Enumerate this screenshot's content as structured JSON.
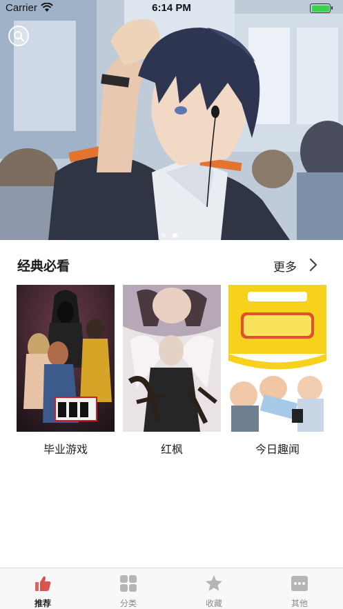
{
  "status_bar": {
    "carrier": "Carrier",
    "time": "6:14 PM",
    "battery_color": "#3bd34b"
  },
  "banner": {
    "search_icon": "search-icon",
    "page_count": 2,
    "active_page": 2
  },
  "section": {
    "title": "经典必看",
    "more_label": "更多",
    "more_icon": "chevron-right-icon"
  },
  "comics": [
    {
      "title": "毕业游戏"
    },
    {
      "title": "红枫"
    },
    {
      "title": "今日趣闻"
    }
  ],
  "tabbar": {
    "active_color": "#d9534f",
    "inactive_color": "#b5b5b5",
    "tabs": [
      {
        "label": "推荐",
        "icon": "thumbs-up-icon",
        "active": true
      },
      {
        "label": "分类",
        "icon": "grid-icon",
        "active": false
      },
      {
        "label": "收藏",
        "icon": "star-icon",
        "active": false
      },
      {
        "label": "其他",
        "icon": "more-dots-icon",
        "active": false
      }
    ]
  }
}
